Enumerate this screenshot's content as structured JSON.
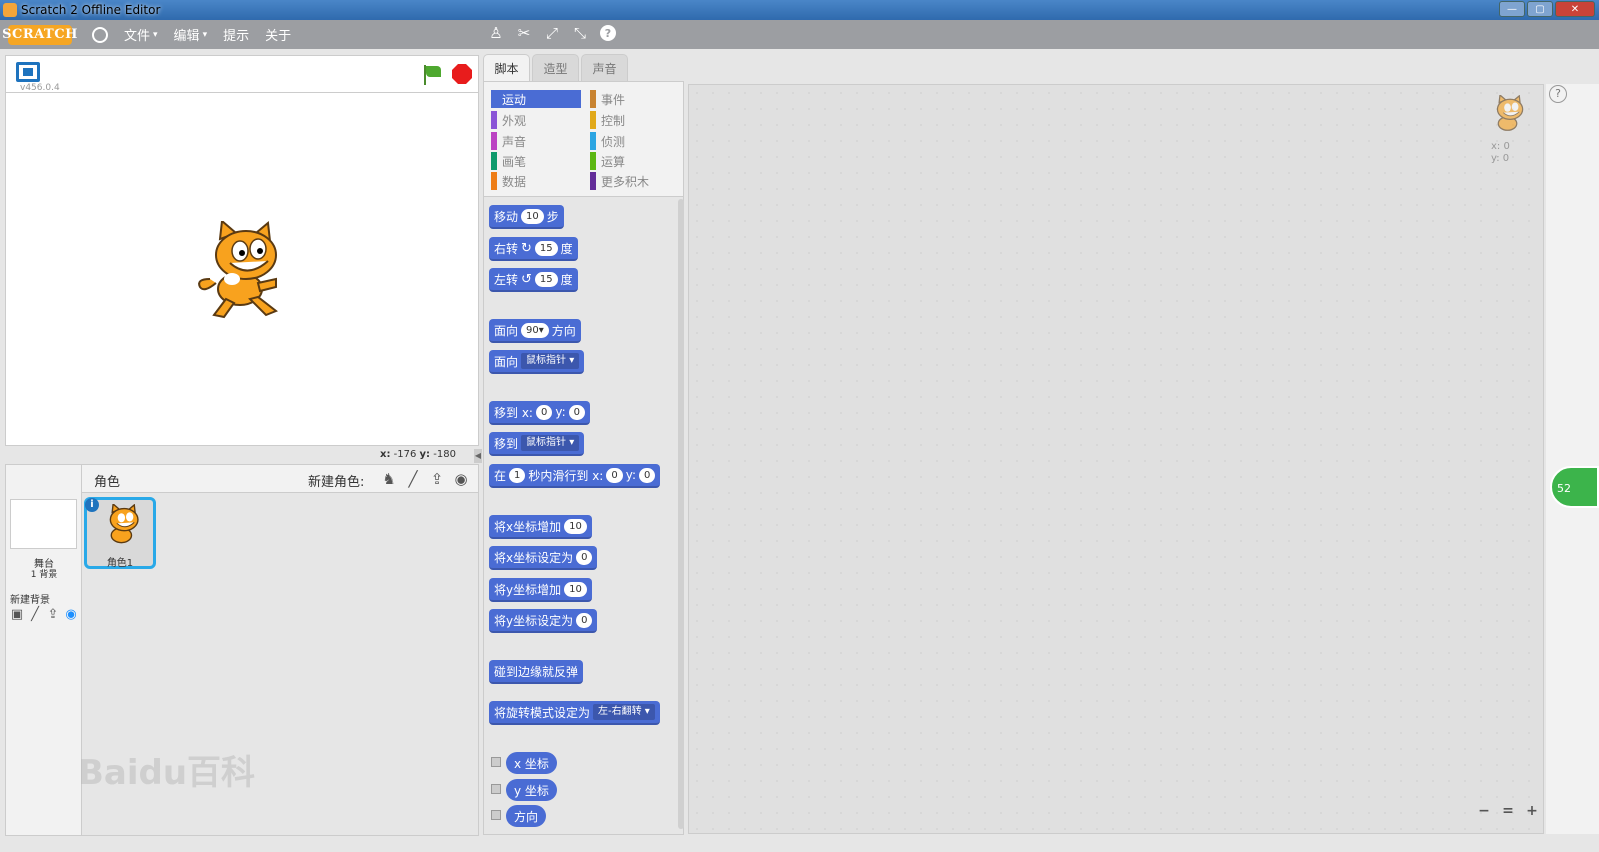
{
  "window": {
    "title": "Scratch 2 Offline Editor"
  },
  "menu": {
    "logo": "SCRATCH",
    "items": [
      {
        "label": "文件",
        "has_dropdown": true
      },
      {
        "label": "编辑",
        "has_dropdown": true
      },
      {
        "label": "提示",
        "has_dropdown": false
      },
      {
        "label": "关于",
        "has_dropdown": false
      }
    ],
    "dropdown_arrow": "▾"
  },
  "stage": {
    "version": "v456.0.4",
    "coords": {
      "x_label": "x:",
      "x_value": "-176",
      "y_label": "y:",
      "y_value": "-180"
    }
  },
  "sprites": {
    "header_label": "角色",
    "new_sprite_label": "新建角色:",
    "stage_name": "舞台",
    "stage_backdrops": "1 背景",
    "new_backdrop_label": "新建背景",
    "sprite_list": [
      {
        "name": "角色1"
      }
    ]
  },
  "tabs": [
    {
      "label": "脚本",
      "active": true
    },
    {
      "label": "造型",
      "active": false
    },
    {
      "label": "声音",
      "active": false
    }
  ],
  "categories": [
    {
      "label": "运动",
      "color": "#4a6cd4",
      "active": true
    },
    {
      "label": "外观",
      "color": "#8a55d7",
      "active": false
    },
    {
      "label": "声音",
      "color": "#bb42c3",
      "active": false
    },
    {
      "label": "画笔",
      "color": "#0e9a6c",
      "active": false
    },
    {
      "label": "数据",
      "color": "#ee7d16",
      "active": false
    },
    {
      "label": "事件",
      "color": "#c88330",
      "active": false
    },
    {
      "label": "控制",
      "color": "#e1a91a",
      "active": false
    },
    {
      "label": "侦测",
      "color": "#2ca5e2",
      "active": false
    },
    {
      "label": "运算",
      "color": "#5cb712",
      "active": false
    },
    {
      "label": "更多积木",
      "color": "#632d99",
      "active": false
    }
  ],
  "blocks": {
    "move": {
      "label": "移动",
      "value": "10",
      "suffix": "步"
    },
    "turn_right": {
      "label": "右转",
      "glyph": "↻",
      "value": "15",
      "suffix": "度"
    },
    "turn_left": {
      "label": "左转",
      "glyph": "↺",
      "value": "15",
      "suffix": "度"
    },
    "point_dir": {
      "label": "面向",
      "value": "90▾",
      "suffix": "方向"
    },
    "point_towards": {
      "label": "面向",
      "dropdown": "鼠标指针 ▾"
    },
    "goto_xy": {
      "label": "移到 x:",
      "x": "0",
      "y_label": "y:",
      "y": "0"
    },
    "goto_target": {
      "label": "移到",
      "dropdown": "鼠标指针 ▾"
    },
    "glide": {
      "label": "在",
      "secs": "1",
      "mid": "秒内滑行到 x:",
      "x": "0",
      "y_label": "y:",
      "y": "0"
    },
    "change_x": {
      "label": "将x坐标增加",
      "value": "10"
    },
    "set_x": {
      "label": "将x坐标设定为",
      "value": "0"
    },
    "change_y": {
      "label": "将y坐标增加",
      "value": "10"
    },
    "set_y": {
      "label": "将y坐标设定为",
      "value": "0"
    },
    "bounce": {
      "label": "碰到边缘就反弹"
    },
    "rotation_style": {
      "label": "将旋转模式设定为",
      "dropdown": "左-右翻转 ▾"
    },
    "x_position": {
      "label": "x 坐标"
    },
    "y_position": {
      "label": "y 坐标"
    },
    "direction": {
      "label": "方向"
    }
  },
  "script_area": {
    "sprite_x": "x: 0",
    "sprite_y": "y: 0",
    "zoom_out": "−",
    "zoom_reset": "=",
    "zoom_in": "+"
  },
  "side": {
    "badge": "52"
  },
  "watermark": "Baidu百科"
}
